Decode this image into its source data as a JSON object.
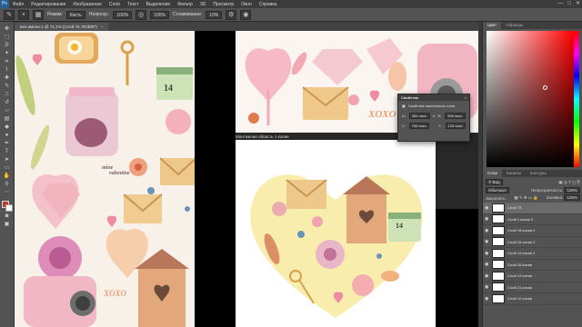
{
  "menubar": {
    "logo": "Ps",
    "items": [
      "Файл",
      "Редактирование",
      "Изображение",
      "Слои",
      "Текст",
      "Выделение",
      "Фильтр",
      "3D",
      "Просмотр",
      "Окно",
      "Справка"
    ],
    "window_buttons": [
      "—",
      "□",
      "✕"
    ]
  },
  "options": {
    "mode_label": "Режим:",
    "mode_value": "Кисть",
    "opacity_label": "Непрозр.:",
    "opacity_value": "100%",
    "smoothing_label": "Сглаживание:",
    "smoothing_value": "10%",
    "pressure_value": "100%"
  },
  "document_tab": {
    "title": "Без имени-1 @ 71,1% (Слой 75, RGB/8*)",
    "close": "×"
  },
  "canvas": {
    "artboard_label": "Монтажная область 1 копия",
    "number_badge": "14",
    "mine_text": "mine",
    "valentine_text": "valentine",
    "xoxo_text": "XOXO"
  },
  "properties_panel": {
    "title": "Свойства",
    "collapse": "»",
    "subtitle": "Свойства пиксельного слоя",
    "w_label": "Ш:",
    "w_value": "384 пикс.",
    "h_label": "В:",
    "h_value": "398 пикс.",
    "x_label": "X:",
    "x_value": "765 пикс.",
    "y_label": "Y:",
    "y_value": "126 пикс."
  },
  "right_panel": {
    "color_tabs": [
      "Цвет",
      "Образцы"
    ],
    "layer_tabs": [
      "Слои",
      "Каналы",
      "Контуры"
    ],
    "kind_label": "Вид",
    "blend_mode": "Обычные",
    "opacity_label": "Непрозрачность:",
    "opacity_value": "100%",
    "lock_label": "Закрепить:",
    "fill_label": "Заливка:",
    "fill_value": "100%",
    "layers": [
      "Слой 75",
      "Слой 1 копия 2",
      "Слой 18 копия 2",
      "Слой 15 копия 2",
      "Слой 14 копия 2",
      "Слой 16 копия",
      "Слой 13 копия",
      "Слой 21 копия",
      "Слой 12 копия"
    ]
  },
  "colors": {
    "foreground": "#c0392b",
    "background": "#ffffff",
    "accent": "#f2a7b6"
  }
}
